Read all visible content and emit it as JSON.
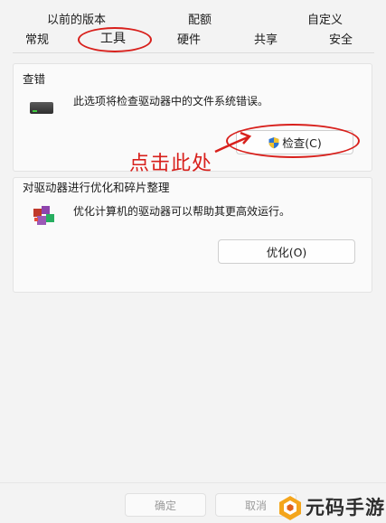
{
  "tabs": {
    "previous_versions": "以前的版本",
    "quota": "配额",
    "customize": "自定义",
    "general": "常规",
    "tools": "工具",
    "hardware": "硬件",
    "sharing": "共享",
    "security": "安全"
  },
  "error_check": {
    "title": "查错",
    "description": "此选项将检查驱动器中的文件系统错误。",
    "button_label": "检查(C)"
  },
  "optimize": {
    "title": "对驱动器进行优化和碎片整理",
    "description": "优化计算机的驱动器可以帮助其更高效运行。",
    "button_label": "优化(O)"
  },
  "annotation": {
    "text": "点击此处",
    "color": "#d8201c"
  },
  "footer": {
    "ok_label": "确定",
    "cancel_label": "取消"
  },
  "watermark": {
    "text": "元码手游网"
  }
}
